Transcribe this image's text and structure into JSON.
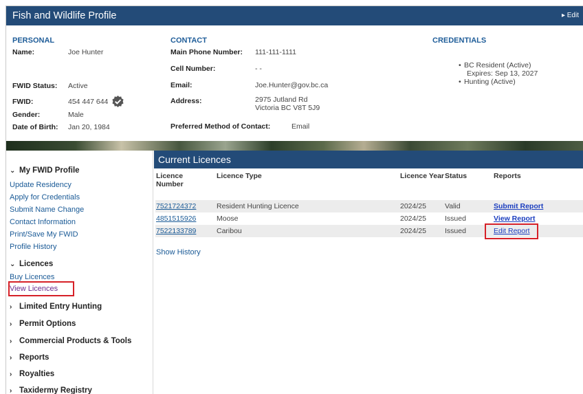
{
  "header": {
    "title": "Fish and Wildlife Profile",
    "edit_label": "▸ Edit"
  },
  "personal": {
    "title": "PERSONAL",
    "name_label": "Name:",
    "name_value": "Joe Hunter",
    "fwid_status_label": "FWID Status:",
    "fwid_status_value": "Active",
    "fwid_label": "FWID:",
    "fwid_value": "454 447 644",
    "gender_label": "Gender:",
    "gender_value": "Male",
    "dob_label": "Date of Birth:",
    "dob_value": "Jan 20, 1984"
  },
  "contact": {
    "title": "CONTACT",
    "main_phone_label": "Main Phone Number:",
    "main_phone_value": "111-111-1111",
    "cell_label": "Cell Number:",
    "cell_value": "-  -",
    "email_label": "Email:",
    "email_value": "Joe.Hunter@gov.bc.ca",
    "address_label": "Address:",
    "address_line1": "2975 Jutland Rd",
    "address_line2": "Victoria BC V8T 5J9",
    "preferred_label": "Preferred Method of Contact:",
    "preferred_value": "Email"
  },
  "credentials": {
    "title": "CREDENTIALS",
    "items": [
      {
        "label": "BC Resident (Active)",
        "sub": "Expires: Sep 13, 2027"
      },
      {
        "label": "Hunting (Active)",
        "sub": ""
      }
    ]
  },
  "sidebar": {
    "my_profile": "My FWID Profile",
    "profile_links": [
      "Update Residency",
      "Apply for Credentials",
      "Submit Name Change",
      "Contact Information",
      "Print/Save My FWID",
      "Profile History"
    ],
    "licences": "Licences",
    "licence_links": [
      "Buy Licences",
      "View Licences"
    ],
    "groups": [
      "Limited Entry Hunting",
      "Permit Options",
      "Commercial Products & Tools",
      "Reports",
      "Royalties",
      "Taxidermy Registry"
    ]
  },
  "main": {
    "title": "Current Licences",
    "columns": {
      "number": "Licence Number",
      "type": "Licence Type",
      "year": "Licence Year",
      "status": "Status",
      "reports": "Reports"
    },
    "rows": [
      {
        "number": "7521724372",
        "type": "Resident Hunting Licence",
        "year": "2024/25",
        "status": "Valid",
        "report": "Submit Report"
      },
      {
        "number": "4851515926",
        "type": "Moose",
        "year": "2024/25",
        "status": "Issued",
        "report": "View Report"
      },
      {
        "number": "7522133789",
        "type": "Caribou",
        "year": "2024/25",
        "status": "Issued",
        "report": "Edit Report"
      }
    ],
    "show_history": "Show History"
  },
  "colors": {
    "header_bg": "#234b78",
    "link": "#1a5a96",
    "highlight": "#d62027",
    "section_title": "#1f5d99"
  }
}
